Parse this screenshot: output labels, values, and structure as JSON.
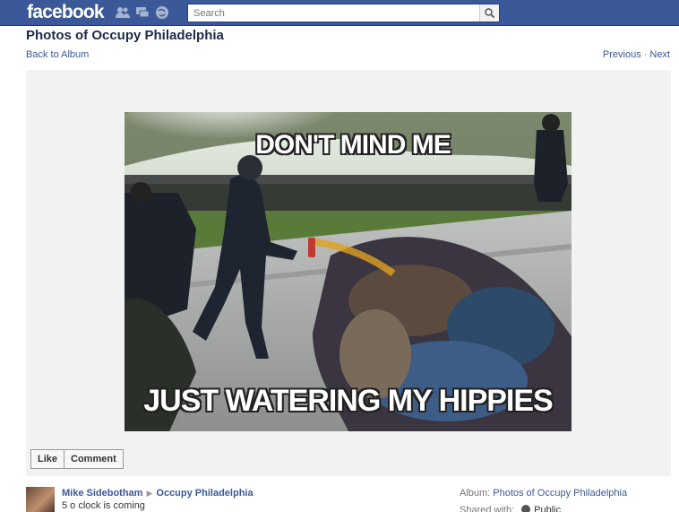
{
  "header": {
    "logo": "facebook",
    "search_placeholder": "Search",
    "icons": [
      "friend-requests-icon",
      "messages-icon",
      "notifications-icon",
      "search-icon"
    ]
  },
  "page": {
    "title": "Photos of Occupy Philadelphia",
    "back_link": "Back to Album",
    "previous": "Previous",
    "separator": "·",
    "next": "Next"
  },
  "photo": {
    "caption_top": "DON'T MIND ME",
    "caption_bottom": "JUST WATERING MY HIPPIES"
  },
  "actions": {
    "like": "Like",
    "comment": "Comment"
  },
  "owner": {
    "name": "Mike Sidebotham",
    "album": "Occupy Philadelphia",
    "description": "5 o clock is coming"
  },
  "album_info": {
    "label": "Album:",
    "value": "Photos of Occupy Philadelphia",
    "shared_label": "Shared with:",
    "shared_value": "Public"
  },
  "colors": {
    "brand": "#3b5998",
    "stage_bg": "#f2f2f2"
  }
}
